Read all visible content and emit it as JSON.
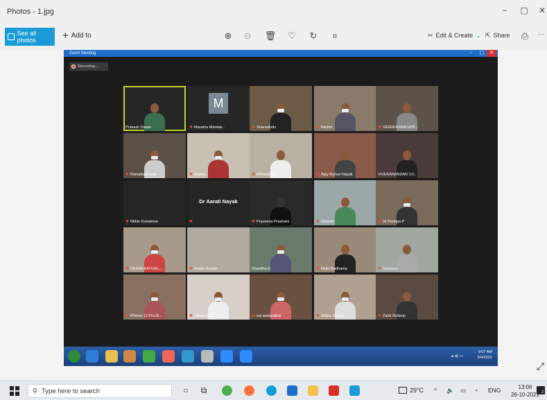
{
  "window": {
    "title": "Photos - 1.jpg",
    "minimize": "−",
    "maximize": "▢",
    "close": "✕"
  },
  "toolbar": {
    "see_all_photos": "See all photos",
    "add_to": "Add to",
    "edit_create": "Edit & Create",
    "share": "Share",
    "more": "···"
  },
  "zoom": {
    "window_title": "Zoom Meeting",
    "recording": "Recording...",
    "participants": [
      "Prakash Diwan",
      "Maratha Mandal...",
      "Sharadindu",
      "Redmi",
      "VEERENDRA UPP...",
      "Ramakant Naik",
      "Redmi",
      "iPhone(Raj)",
      "Ajay Kumar Nayak",
      "VIVEKANANDAN V.C.",
      "Nithin Kuriakose",
      "",
      "Praveena Prashant",
      "Naveen",
      "Dr Pushpa P",
      "DEEPA KATGAL...",
      "Aswin Joseph",
      "Shwetha D",
      "Nidhi Dadhania",
      "Sowmya",
      "iPhone 12 Pro M...",
      "Vikram Pai",
      "sai walawalkar",
      "Shilpa Soman",
      "Zahir Ruttonji"
    ],
    "avatar_letter": "M",
    "name_only_tile": "Dr Aarati Nayak",
    "inner_clock_time": "9:07 AM",
    "inner_clock_date": "5/4/2021"
  },
  "taskbar": {
    "search_placeholder": "Type here to search",
    "temperature": "29°C",
    "language": "ENG",
    "time": "13:06",
    "date": "26-10-2021",
    "notification_count": "2"
  },
  "colors": {
    "accent": "#1a9bd7",
    "zoom_blue": "#1e6ec8",
    "active_speaker": "#c7d22c"
  }
}
